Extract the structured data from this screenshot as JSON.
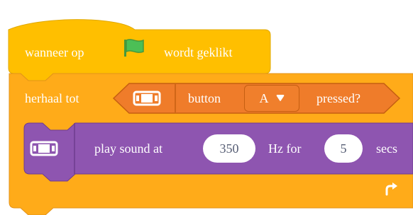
{
  "hat_block": {
    "text_before": "wanneer op",
    "text_after": "wordt geklikt",
    "icon": "green-flag-icon",
    "color": "#FFBF00"
  },
  "repeat_block": {
    "label": "herhaal tot",
    "color": "#FFAB19",
    "loop_icon": "loop-arrow-icon"
  },
  "condition_block": {
    "icon": "gamepad-extension-icon",
    "text_before": "button",
    "dropdown_value": "A",
    "text_after": "pressed?",
    "color": "#E6792C"
  },
  "sound_block": {
    "icon": "gamepad-extension-icon",
    "text1": "play sound at",
    "frequency": "350",
    "text2": "Hz for",
    "duration": "5",
    "text3": "secs",
    "color": "#8E55B0"
  }
}
